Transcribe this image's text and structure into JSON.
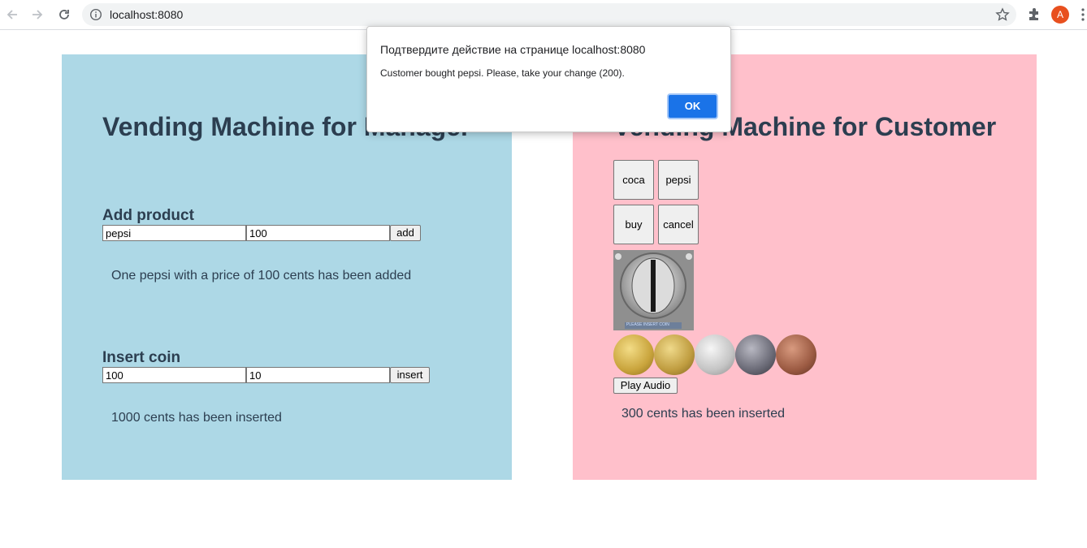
{
  "browser": {
    "url": "localhost:8080",
    "avatar_letter": "A"
  },
  "manager": {
    "title": "Vending Machine for Manager",
    "add_product": {
      "heading": "Add product",
      "name_value": "pepsi",
      "price_value": "100",
      "button_label": "add",
      "message": "One pepsi with a price of 100 cents has been added"
    },
    "insert_coin": {
      "heading": "Insert coin",
      "value_value": "100",
      "count_value": "10",
      "button_label": "insert",
      "message": "1000 cents has been inserted"
    }
  },
  "customer": {
    "title": "Vending Machine for Customer",
    "products": [
      "coca",
      "pepsi"
    ],
    "actions": [
      "buy",
      "cancel"
    ],
    "slot_image_text": "PLEASE INSERT COIN",
    "coin_images": [
      "gold-kiwi-coin",
      "gold-2-dollar-coin",
      "silver-ship-coin",
      "dark-20-coin",
      "copper-10-coin"
    ],
    "play_audio_label": "Play Audio",
    "message": "300 cents has been inserted"
  },
  "dialog": {
    "title": "Подтвердите действие на странице localhost:8080",
    "message": "Customer bought pepsi. Please, take your change (200).",
    "ok_label": "OK"
  },
  "colors": {
    "manager_bg": "#add8e6",
    "customer_bg": "#ffc0cb",
    "heading": "#2c3e50",
    "dialog_button": "#1a73e8"
  }
}
